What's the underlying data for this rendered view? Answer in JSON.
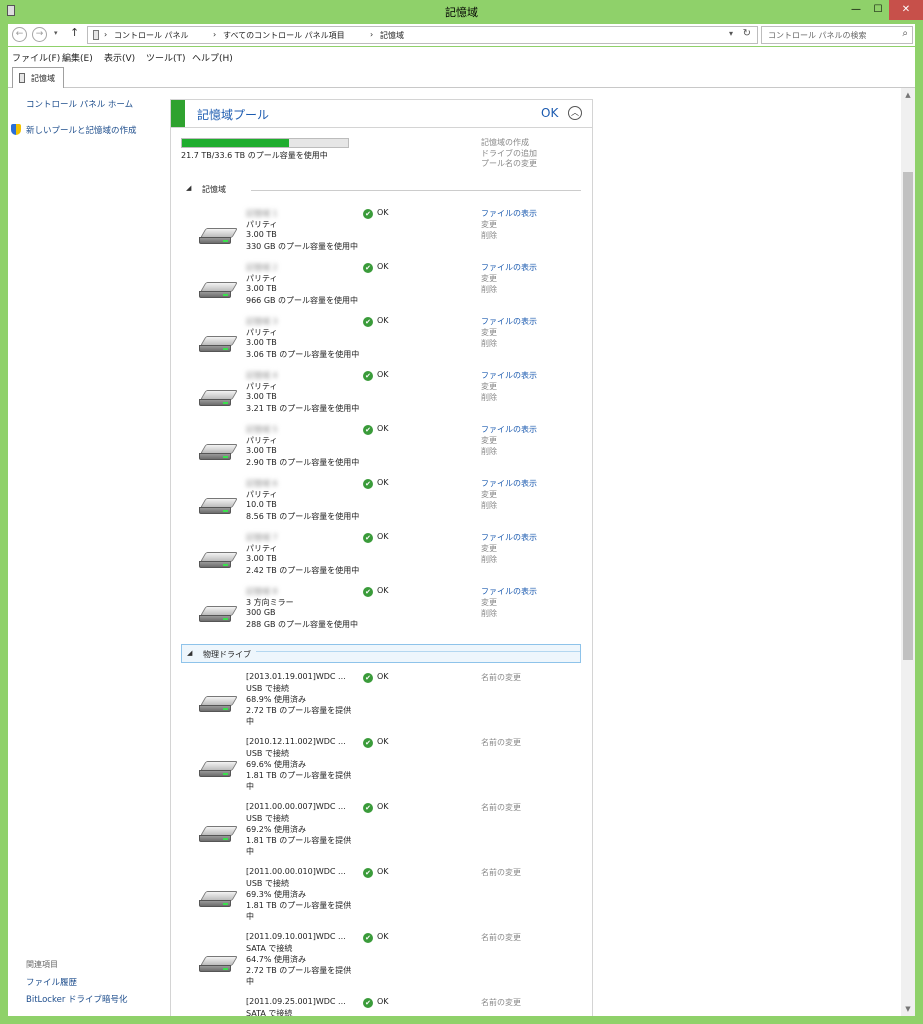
{
  "window": {
    "title": "記憶域",
    "min": "—",
    "max": "☐",
    "close": "✕"
  },
  "address": {
    "crumbs": [
      "コントロール パネル",
      "すべてのコントロール パネル項目",
      "記憶域"
    ],
    "search_placeholder": "コントロール パネルの検索"
  },
  "menu": [
    "ファイル(F)",
    "編集(E)",
    "表示(V)",
    "ツール(T)",
    "ヘルプ(H)"
  ],
  "tab": "記憶域",
  "sidebar": {
    "home": "コントロール パネル ホーム",
    "create": "新しいプールと記憶域の作成",
    "related_title": "関連項目",
    "related": [
      "ファイル履歴",
      "BitLocker ドライブ暗号化"
    ]
  },
  "pool": {
    "title": "記憶域プール",
    "status": "OK",
    "usage_text": "21.7 TB/33.6 TB のプール容量を使用中",
    "usage_fraction": 0.646,
    "links": [
      "記憶域の作成",
      "ドライブの追加",
      "プール名の変更"
    ]
  },
  "spaces_section": "記憶域",
  "spaces": [
    {
      "name": "記憶域 1",
      "status": "OK",
      "type": "パリティ",
      "size": "3.00 TB",
      "used": "330 GB のプール容量を使用中"
    },
    {
      "name": "記憶域 2",
      "status": "OK",
      "type": "パリティ",
      "size": "3.00 TB",
      "used": "966 GB のプール容量を使用中"
    },
    {
      "name": "記憶域 3",
      "status": "OK",
      "type": "パリティ",
      "size": "3.00 TB",
      "used": "3.06 TB のプール容量を使用中"
    },
    {
      "name": "記憶域 4",
      "status": "OK",
      "type": "パリティ",
      "size": "3.00 TB",
      "used": "3.21 TB のプール容量を使用中"
    },
    {
      "name": "記憶域 5",
      "status": "OK",
      "type": "パリティ",
      "size": "3.00 TB",
      "used": "2.90 TB のプール容量を使用中"
    },
    {
      "name": "記憶域 6",
      "status": "OK",
      "type": "パリティ",
      "size": "10.0 TB",
      "used": "8.56 TB のプール容量を使用中"
    },
    {
      "name": "記憶域 7",
      "status": "OK",
      "type": "パリティ",
      "size": "3.00 TB",
      "used": "2.42 TB のプール容量を使用中"
    },
    {
      "name": "記憶域 8",
      "status": "OK",
      "type": "3 方向ミラー",
      "size": "300 GB",
      "used": "288 GB のプール容量を使用中"
    }
  ],
  "space_links": {
    "view": "ファイルの表示",
    "change": "変更",
    "delete": "削除"
  },
  "drives_section": "物理ドライブ",
  "drives": [
    {
      "name": "[2013.01.19.001]WDC ...",
      "status": "OK",
      "conn": "USB で接続",
      "pct": "68.9% 使用済み",
      "prov1": "2.72 TB のプール容量を提供",
      "prov2": "中"
    },
    {
      "name": "[2010.12.11.002]WDC ...",
      "status": "OK",
      "conn": "USB で接続",
      "pct": "69.6% 使用済み",
      "prov1": "1.81 TB のプール容量を提供",
      "prov2": "中"
    },
    {
      "name": "[2011.00.00.007]WDC ...",
      "status": "OK",
      "conn": "USB で接続",
      "pct": "69.2% 使用済み",
      "prov1": "1.81 TB のプール容量を提供",
      "prov2": "中"
    },
    {
      "name": "[2011.00.00.010]WDC ...",
      "status": "OK",
      "conn": "USB で接続",
      "pct": "69.3% 使用済み",
      "prov1": "1.81 TB のプール容量を提供",
      "prov2": "中"
    },
    {
      "name": "[2011.09.10.001]WDC ...",
      "status": "OK",
      "conn": "SATA で接続",
      "pct": "64.7% 使用済み",
      "prov1": "2.72 TB のプール容量を提供",
      "prov2": "中"
    },
    {
      "name": "[2011.09.25.001]WDC ...",
      "status": "OK",
      "conn": "SATA で接続",
      "pct": "",
      "prov1": "",
      "prov2": ""
    }
  ],
  "drive_link": "名前の変更"
}
